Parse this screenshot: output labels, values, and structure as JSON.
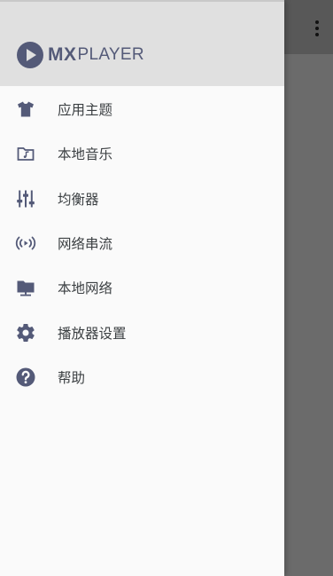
{
  "app": {
    "logo_mx": "MX",
    "logo_player": "PLAYER"
  },
  "colors": {
    "icon": "#545a78",
    "text": "#3c4043",
    "header_bg": "#e0e0e0",
    "drawer_bg": "#fafafa",
    "scrim": "#6b6b6b"
  },
  "menu": {
    "items": [
      {
        "label": "应用主题",
        "icon": "tshirt-icon"
      },
      {
        "label": "本地音乐",
        "icon": "music-folder-icon"
      },
      {
        "label": "均衡器",
        "icon": "equalizer-icon"
      },
      {
        "label": "网络串流",
        "icon": "stream-icon"
      },
      {
        "label": "本地网络",
        "icon": "network-folder-icon"
      },
      {
        "label": "播放器设置",
        "icon": "gear-icon"
      },
      {
        "label": "帮助",
        "icon": "help-icon"
      }
    ]
  }
}
